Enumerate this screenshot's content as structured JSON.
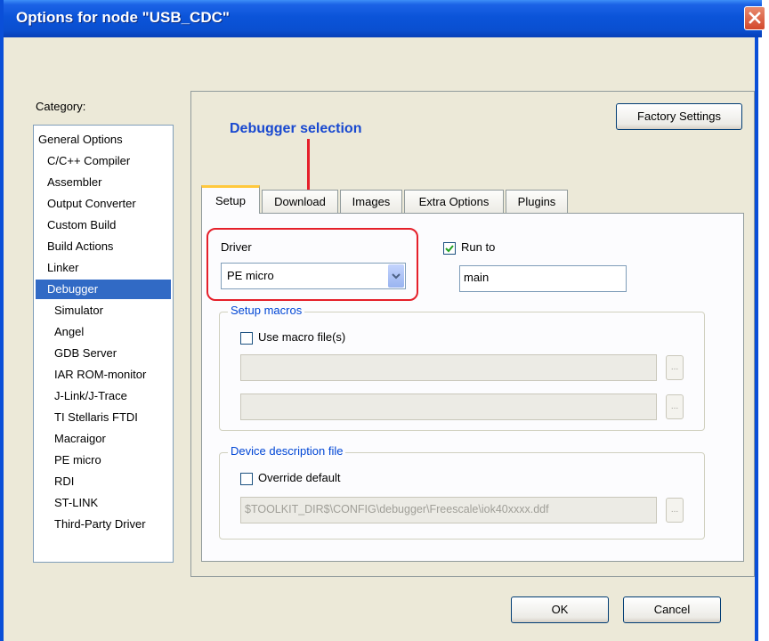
{
  "window": {
    "title": "Options for node \"USB_CDC\""
  },
  "category": {
    "label": "Category:",
    "items": [
      "General Options",
      "C/C++ Compiler",
      "Assembler",
      "Output Converter",
      "Custom Build",
      "Build Actions",
      "Linker",
      "Debugger",
      "Simulator",
      "Angel",
      "GDB Server",
      "IAR ROM-monitor",
      "J-Link/J-Trace",
      "TI Stellaris FTDI",
      "Macraigor",
      "PE micro",
      "RDI",
      "ST-LINK",
      "Third-Party Driver"
    ],
    "selected": "Debugger"
  },
  "factory_settings_label": "Factory Settings",
  "annotation": {
    "text": "Debugger selection",
    "color": "#1848d0",
    "line_color": "#e5202a"
  },
  "tabs": [
    "Setup",
    "Download",
    "Images",
    "Extra Options",
    "Plugins"
  ],
  "active_tab": "Setup",
  "setup": {
    "driver_label": "Driver",
    "driver_value": "PE micro",
    "run_to_label": "Run to",
    "run_to_checked": true,
    "run_to_value": "main",
    "setup_macros": {
      "title": "Setup macros",
      "use_macro_label": "Use macro file(s)",
      "use_macro_checked": false,
      "macro_file_1": "",
      "macro_file_2": ""
    },
    "device_description": {
      "title": "Device description file",
      "override_label": "Override default",
      "override_checked": false,
      "path": "$TOOLKIT_DIR$\\CONFIG\\debugger\\Freescale\\iok40xxxx.ddf"
    }
  },
  "buttons": {
    "ok": "OK",
    "cancel": "Cancel",
    "ellipsis": "..."
  },
  "colors": {
    "titlebar": "#0a4fd8",
    "selection": "#316ac5",
    "group_title": "#0046d5",
    "highlight": "#e5202a"
  }
}
